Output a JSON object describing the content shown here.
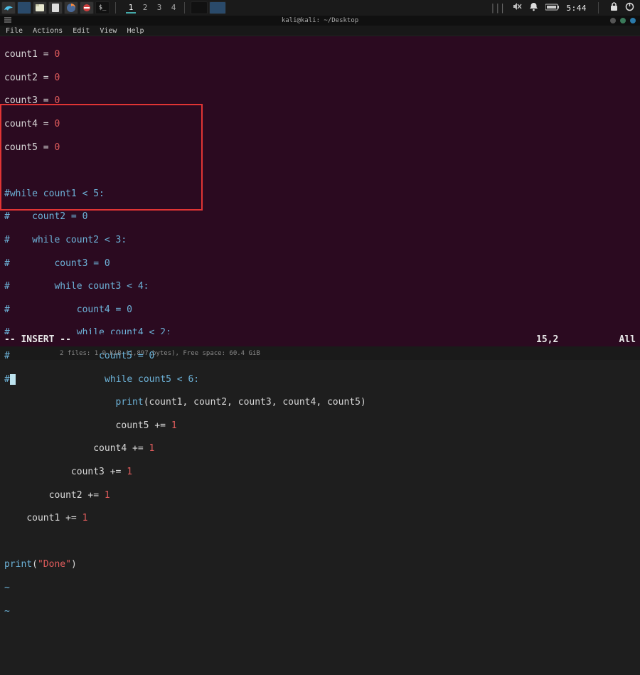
{
  "topbar": {
    "workspaces": [
      "1",
      "2",
      "3",
      "4"
    ],
    "active_ws": 0,
    "clock": "5:44",
    "slashes": "|||"
  },
  "window": {
    "title": "kali@kali: ~/Desktop"
  },
  "menubar": [
    "File",
    "Actions",
    "Edit",
    "View",
    "Help"
  ],
  "code": {
    "l1_a": "count1",
    "l1_b": " = ",
    "l1_c": "0",
    "l2_a": "count2",
    "l2_b": " = ",
    "l2_c": "0",
    "l3_a": "count3",
    "l3_b": " = ",
    "l3_c": "0",
    "l4_a": "count4",
    "l4_b": " = ",
    "l4_c": "0",
    "l5_a": "count5",
    "l5_b": " = ",
    "l5_c": "0",
    "l7": "#while count1 < 5:",
    "l8": "#    count2 = 0",
    "l9": "#    while count2 < 3:",
    "l10": "#        count3 = 0",
    "l11": "#        while count3 < 4:",
    "l12": "#            count4 = 0",
    "l13": "#            while count4 < 2:",
    "l14": "#                count5 = 0",
    "l15a": "#",
    "l15b": "                while count5 < 6:",
    "l16_ind": "                    ",
    "l16_fn": "print",
    "l16_args": "(count1, count2, count3, count4, count5)",
    "l17_ind": "                    ",
    "l17_txt": "count5 += ",
    "l17_n": "1",
    "l18_ind": "                ",
    "l18_txt": "count4 += ",
    "l18_n": "1",
    "l19_ind": "            ",
    "l19_txt": "count3 += ",
    "l19_n": "1",
    "l20_ind": "        ",
    "l20_txt": "count2 += ",
    "l20_n": "1",
    "l21_ind": "    ",
    "l21_txt": "count1 += ",
    "l21_n": "1",
    "l23_fn": "print",
    "l23_a": "(",
    "l23_s": "\"Done\"",
    "l23_b": ")",
    "tilde": "~"
  },
  "status": {
    "mode": "-- INSERT --",
    "pos": "15,2",
    "pct": "All"
  },
  "bottombar": {
    "text": "2 files: 1.9 KiB (1,897 bytes), Free space: 60.4 GiB"
  }
}
